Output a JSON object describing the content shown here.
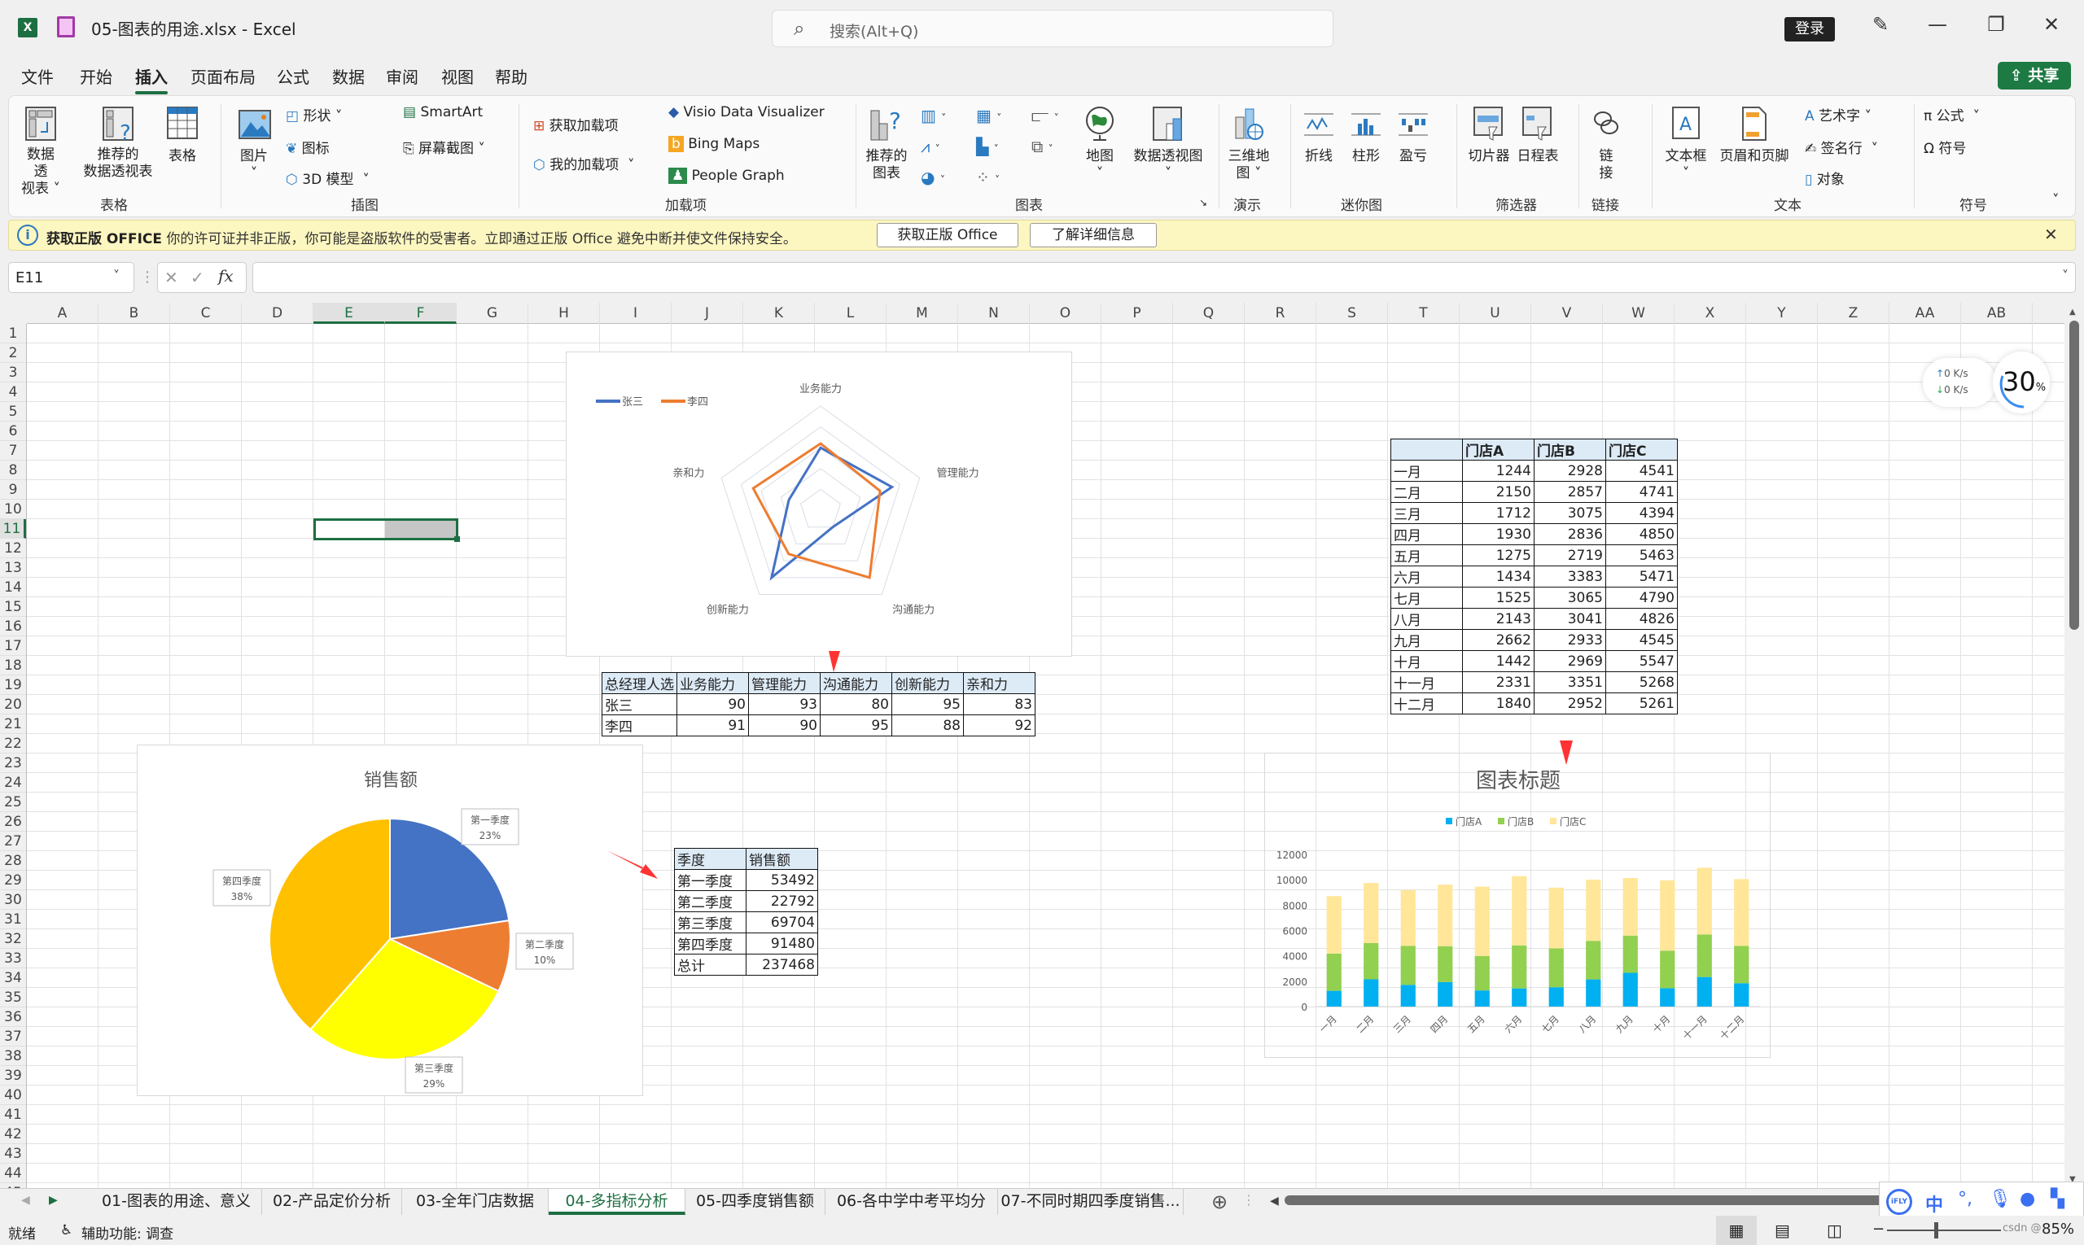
{
  "app": {
    "title": "05-图表的用途.xlsx  -  Excel",
    "search_placeholder": "搜索(Alt+Q)",
    "login_label": "登录",
    "share_label": "共享"
  },
  "menu": [
    "文件",
    "开始",
    "插入",
    "页面布局",
    "公式",
    "数据",
    "审阅",
    "视图",
    "帮助"
  ],
  "menu_active": "插入",
  "ribbon": {
    "groups": {
      "tables": "表格",
      "illustrations": "插图",
      "addins": "加载项",
      "charts": "图表",
      "tours": "演示",
      "sparklines": "迷你图",
      "filters": "筛选器",
      "links": "链接",
      "text": "文本",
      "symbols": "符号"
    },
    "pivot_table": "数据透视表",
    "recommended_pivot": "推荐的数据透视表",
    "table": "表格",
    "picture": "图片",
    "shapes": "形状",
    "icons": "图标",
    "model3d": "3D 模型",
    "smartart": "SmartArt",
    "screenshot": "屏幕截图",
    "get_addins": "获取加载项",
    "my_addins": "我的加载项",
    "visio": "Visio Data Visualizer",
    "bing_maps": "Bing Maps",
    "people_graph": "People Graph",
    "recommended_charts": "推荐的图表",
    "maps": "地图",
    "pivot_chart": "数据透视图",
    "map3d": "三维地图",
    "spark_line": "折线",
    "spark_column": "柱形",
    "spark_winloss": "盈亏",
    "slicer": "切片器",
    "timeline": "日程表",
    "link": "链接",
    "textbox": "文本框",
    "header_footer": "页眉和页脚",
    "wordart": "艺术字",
    "signature": "签名行",
    "object": "对象",
    "equation": "公式",
    "symbol": "符号"
  },
  "banner": {
    "bold": "获取正版 OFFICE",
    "text": "你的许可证并非正版，你可能是盗版软件的受害者。立即通过正版 Office 避免中断并使文件保持安全。",
    "btn_get": "获取正版 Office",
    "btn_learn": "了解详细信息"
  },
  "formula_bar": {
    "name_box": "E11",
    "fx": "fx",
    "value": ""
  },
  "columns": [
    "A",
    "B",
    "C",
    "D",
    "E",
    "F",
    "G",
    "H",
    "I",
    "J",
    "K",
    "L",
    "M",
    "N",
    "O",
    "P",
    "Q",
    "R",
    "S",
    "T",
    "U",
    "V",
    "W",
    "X",
    "Y",
    "Z",
    "AA",
    "AB"
  ],
  "selected_cell": "E11",
  "radar_table": {
    "headers": [
      "总经理人选",
      "业务能力",
      "管理能力",
      "沟通能力",
      "创新能力",
      "亲和力"
    ],
    "rows": [
      [
        "张三",
        "90",
        "93",
        "80",
        "95",
        "83"
      ],
      [
        "李四",
        "91",
        "90",
        "95",
        "88",
        "92"
      ]
    ]
  },
  "pie_table": {
    "headers": [
      "季度",
      "销售额"
    ],
    "rows": [
      [
        "第一季度",
        "53492"
      ],
      [
        "第二季度",
        "22792"
      ],
      [
        "第三季度",
        "69704"
      ],
      [
        "第四季度",
        "91480"
      ],
      [
        "总计",
        "237468"
      ]
    ]
  },
  "store_table": {
    "headers": [
      "",
      "门店A",
      "门店B",
      "门店C"
    ],
    "rows": [
      [
        "一月",
        "1244",
        "2928",
        "4541"
      ],
      [
        "二月",
        "2150",
        "2857",
        "4741"
      ],
      [
        "三月",
        "1712",
        "3075",
        "4394"
      ],
      [
        "四月",
        "1930",
        "2836",
        "4850"
      ],
      [
        "五月",
        "1275",
        "2719",
        "5463"
      ],
      [
        "六月",
        "1434",
        "3383",
        "5471"
      ],
      [
        "七月",
        "1525",
        "3065",
        "4790"
      ],
      [
        "八月",
        "2143",
        "3041",
        "4826"
      ],
      [
        "九月",
        "2662",
        "2933",
        "4545"
      ],
      [
        "十月",
        "1442",
        "2969",
        "5547"
      ],
      [
        "十一月",
        "2331",
        "3351",
        "5268"
      ],
      [
        "十二月",
        "1840",
        "2952",
        "5261"
      ]
    ]
  },
  "chart_data": [
    {
      "type": "radar",
      "title": "",
      "categories": [
        "业务能力",
        "管理能力",
        "沟通能力",
        "创新能力",
        "亲和力"
      ],
      "series": [
        {
          "name": "张三",
          "color": "#4472c4",
          "values": [
            90,
            93,
            80,
            95,
            83
          ]
        },
        {
          "name": "李四",
          "color": "#ed7d31",
          "values": [
            91,
            90,
            95,
            88,
            92
          ]
        }
      ],
      "range": [
        75,
        100
      ],
      "legend": "top-left"
    },
    {
      "type": "pie",
      "title": "销售额",
      "categories": [
        "第一季度",
        "第二季度",
        "第三季度",
        "第四季度"
      ],
      "values": [
        53492,
        22792,
        69704,
        91480
      ],
      "percent_labels": [
        "23%",
        "10%",
        "29%",
        "38%"
      ],
      "colors": [
        "#4472c4",
        "#ed7d31",
        "#ffff00",
        "#ffc000"
      ]
    },
    {
      "type": "bar",
      "stacked": true,
      "title": "图表标题",
      "categories": [
        "一月",
        "二月",
        "三月",
        "四月",
        "五月",
        "六月",
        "七月",
        "八月",
        "九月",
        "十月",
        "十一月",
        "十二月"
      ],
      "series": [
        {
          "name": "门店A",
          "color": "#00b0f0",
          "values": [
            1244,
            2150,
            1712,
            1930,
            1275,
            1434,
            1525,
            2143,
            2662,
            1442,
            2331,
            1840
          ]
        },
        {
          "name": "门店B",
          "color": "#92d050",
          "values": [
            2928,
            2857,
            3075,
            2836,
            2719,
            3383,
            3065,
            3041,
            2933,
            2969,
            3351,
            2952
          ]
        },
        {
          "name": "门店C",
          "color": "#ffe699",
          "values": [
            4541,
            4741,
            4394,
            4850,
            5463,
            5471,
            4790,
            4826,
            4545,
            5547,
            5268,
            5261
          ]
        }
      ],
      "ylim": [
        0,
        12000
      ],
      "yticks": [
        "0",
        "2000",
        "4000",
        "6000",
        "8000",
        "10000",
        "12000"
      ],
      "legend": "top"
    }
  ],
  "sheet_tabs": [
    "01-图表的用途、意义",
    "02-产品定价分析",
    "03-全年门店数据",
    "04-多指标分析",
    "05-四季度销售额",
    "06-各中学中考平均分",
    "07-不同时期四季度销售..."
  ],
  "active_tab": "04-多指标分析",
  "status": {
    "ready": "就绪",
    "accessibility": "辅助功能: 调查",
    "zoom": "85%",
    "watermark": "csdn @"
  },
  "overlay": {
    "net_up": "0  K/s",
    "net_down": "0  K/s",
    "cpu": "30",
    "cpu_unit": "%",
    "ime_logo": "iFLY",
    "ime_lang": "中"
  }
}
